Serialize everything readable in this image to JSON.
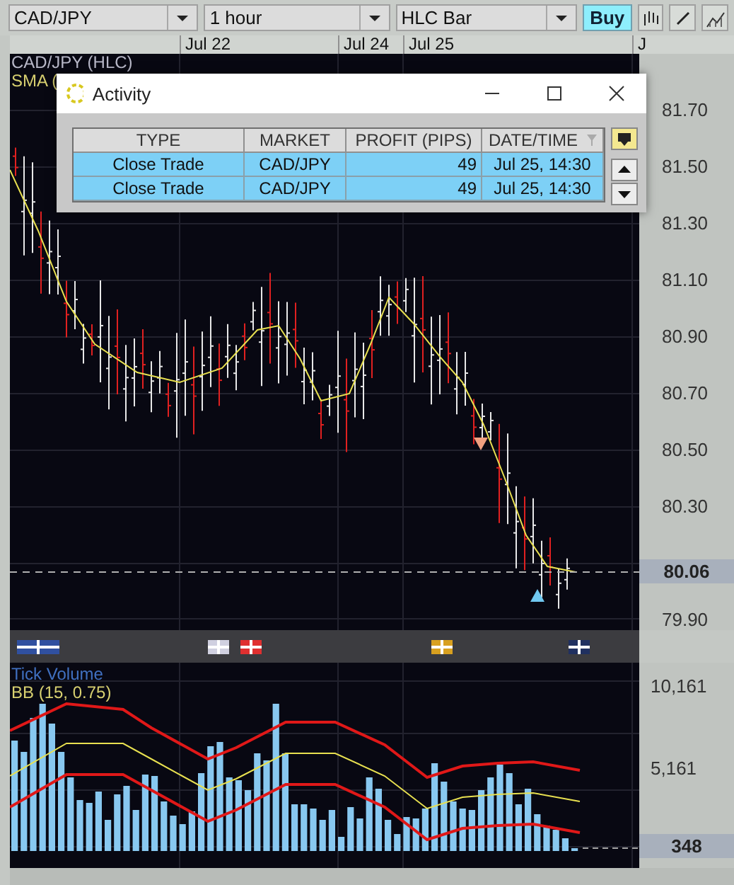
{
  "toolbar": {
    "symbol": "CAD/JPY",
    "timeframe": "1 hour",
    "chart_type": "HLC Bar",
    "buy_button": "Buy"
  },
  "date_axis": [
    "Jul 22",
    "Jul 24",
    "Jul 25",
    "J"
  ],
  "price_chart": {
    "legend": [
      "CAD/JPY (HLC)",
      "SMA ("
    ],
    "price_axis": [
      "81.70",
      "81.50",
      "81.30",
      "81.10",
      "80.90",
      "80.70",
      "80.50",
      "80.30",
      "79.90"
    ],
    "current_price": "80.06"
  },
  "activity": {
    "title": "Activity",
    "columns": [
      "TYPE",
      "MARKET",
      "PROFIT (PIPS)",
      "DATE/TIME"
    ],
    "rows": [
      {
        "cells": [
          "Close Trade",
          "CAD/JPY",
          "49",
          "Jul 25, 14:30"
        ],
        "selected": true
      },
      {
        "cells": [
          "Close Trade",
          "CAD/JPY",
          "49",
          "Jul 25, 14:30"
        ],
        "selected": true
      }
    ]
  },
  "volume_chart": {
    "legend": [
      "Tick Volume",
      "BB (15, 0.75)"
    ],
    "axis": [
      "10,161",
      "5,161"
    ],
    "current_value": "348"
  }
}
